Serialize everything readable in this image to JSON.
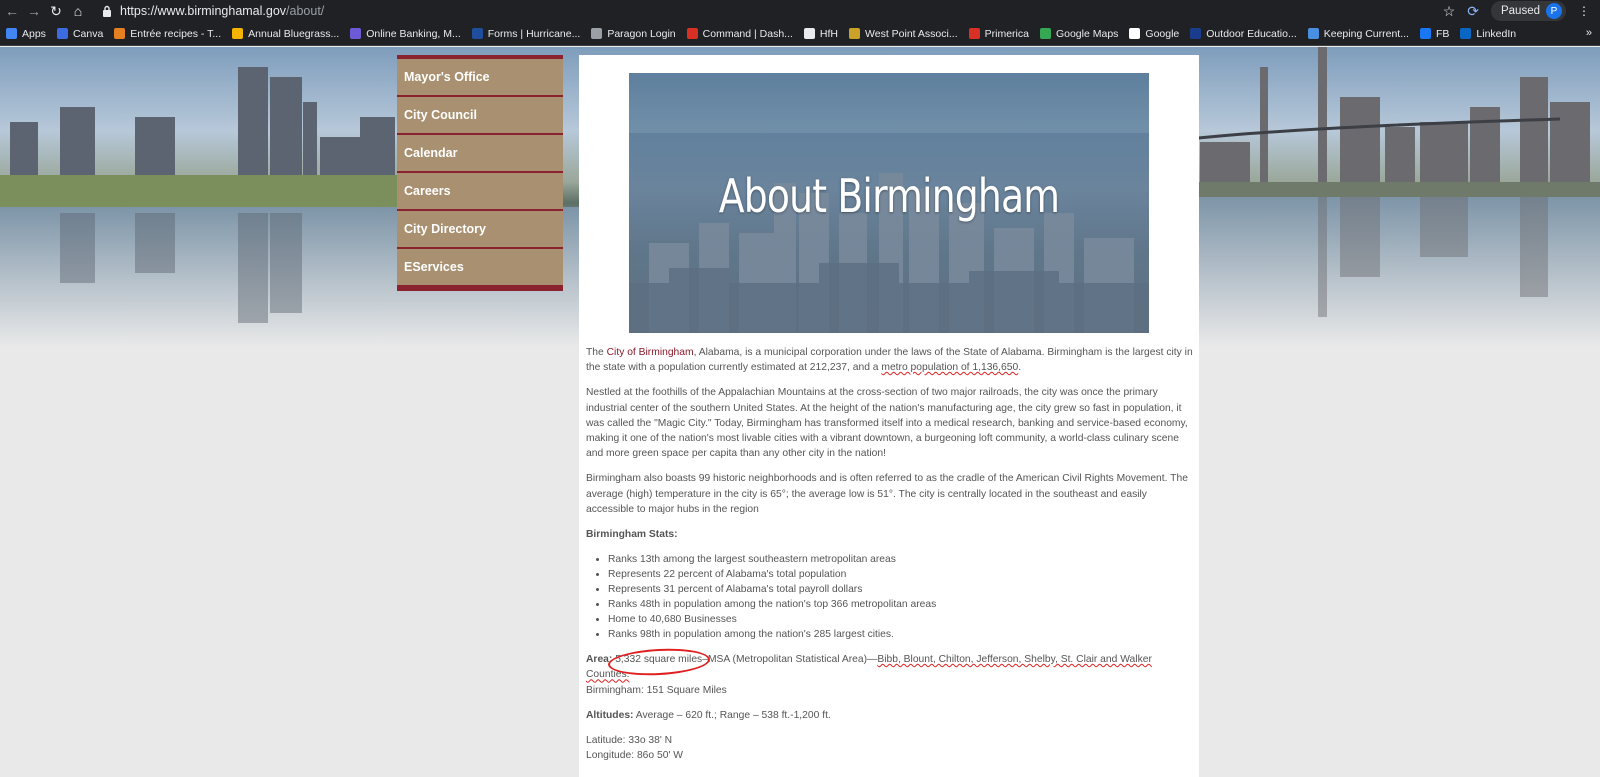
{
  "browser": {
    "url_host": "https://www.birminghamal.gov",
    "url_path": "/about/",
    "paused_label": "Paused",
    "avatar_letter": "P",
    "bookmarks": [
      {
        "label": "Apps",
        "color": "#4285f4"
      },
      {
        "label": "Canva",
        "color": "#3d6be0"
      },
      {
        "label": "Entrée recipes - T...",
        "color": "#e67e22"
      },
      {
        "label": "Annual Bluegrass...",
        "color": "#f4b400"
      },
      {
        "label": "Online Banking, M...",
        "color": "#6b5bd6"
      },
      {
        "label": "Forms | Hurricane...",
        "color": "#1f4e9c"
      },
      {
        "label": "Paragon Login",
        "color": "#9aa0a6"
      },
      {
        "label": "Command | Dash...",
        "color": "#d93025"
      },
      {
        "label": "HfH",
        "color": "#e8eaed"
      },
      {
        "label": "West Point Associ...",
        "color": "#c9a227"
      },
      {
        "label": "Primerica",
        "color": "#d93025"
      },
      {
        "label": "Google Maps",
        "color": "#34a853"
      },
      {
        "label": "Google",
        "color": "#ffffff"
      },
      {
        "label": "Outdoor Educatio...",
        "color": "#1a3c8c"
      },
      {
        "label": "Keeping Current...",
        "color": "#4a90e2"
      },
      {
        "label": "FB",
        "color": "#1877f2"
      },
      {
        "label": "LinkedIn",
        "color": "#0a66c2"
      }
    ]
  },
  "sidenav": [
    {
      "label": "Mayor's Office"
    },
    {
      "label": "City Council"
    },
    {
      "label": "Calendar"
    },
    {
      "label": "Careers"
    },
    {
      "label": "City Directory"
    },
    {
      "label": "EServices"
    }
  ],
  "banner_title": "About Birmingham",
  "p1": {
    "pre": "The ",
    "link": "City of Birmingham",
    "mid": ", Alabama, is a municipal corporation under the laws of the State of Alabama. Birmingham is the largest city in the state with a population currently estimated at 212,237, and a ",
    "underlined": "metro population of 1,136,650",
    "post": "."
  },
  "p2": "Nestled at the foothills of the Appalachian Mountains at the cross-section of two major railroads, the city was once the primary industrial center of the southern United States. At the height of the nation's manufacturing age, the city grew so fast in population, it was called the \"Magic City.\" Today, Birmingham has transformed itself into a medical research, banking and service-based economy, making it one of the nation's most livable cities with a vibrant downtown, a burgeoning loft community, a world-class culinary scene and more green space per capita than any other city in the nation!",
  "p3": "Birmingham also boasts 99 historic neighborhoods and is often referred to as the cradle of the American Civil Rights Movement. The average (high) temperature in the city is 65°; the average low is 51°. The city is centrally located in the southeast and easily accessible to major hubs in the region",
  "stats_heading": "Birmingham Stats:",
  "stats": [
    "Ranks 13th among the largest southeastern metropolitan areas",
    "Represents 22 percent of Alabama's total population",
    "Represents 31 percent of Alabama's total payroll dollars",
    "Ranks 48th in population among the nation's top 366 metropolitan areas",
    "Home to 40,680 Businesses",
    "Ranks 98th in population among the nation's 285 largest cities."
  ],
  "area": {
    "label": "Area:",
    "circled": "5,332 square miles",
    "mid": "–MSA (Metropolitan Statistical Area)—",
    "underlined": "Bibb, Blount, Chilton, Jefferson, Shelby, St. Clair and Walker Counties.",
    "city": "Birmingham: 151 Square Miles"
  },
  "altitudes": {
    "label": "Altitudes:",
    "value": " Average – 620 ft.; Range – 538 ft.-1,200 ft."
  },
  "latitude": "Latitude: 33o 38' N",
  "longitude": "Longitude: 86o 50' W"
}
